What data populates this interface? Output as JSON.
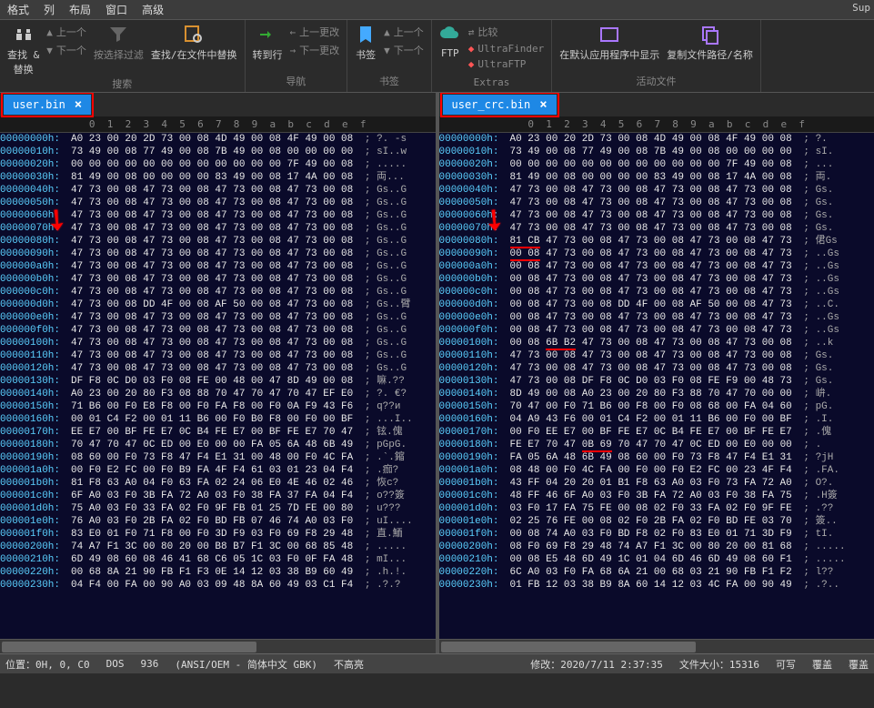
{
  "menu": {
    "items": [
      "格式",
      "列",
      "布局",
      "窗口",
      "高级"
    ]
  },
  "ribbon": {
    "find": {
      "label": "查找 &\n替换",
      "prev": "上一个",
      "next": "下一个"
    },
    "filter": "按选择过滤",
    "findInFiles": "查找/在文件中替换",
    "searchGroup": "搜索",
    "gotoLine": "转到行",
    "prevChange": "上一更改",
    "nextChange": "下一更改",
    "navGroup": "导航",
    "bookmark": {
      "label": "书签",
      "prev": "上一个",
      "next": "下一个"
    },
    "bmGroup": "书签",
    "ftp": "FTP",
    "compare": "比较",
    "ultrafinder": "UltraFinder",
    "ultraftp": "UltraFTP",
    "extrasGroup": "Extras",
    "openDefault": "在默认应用程序中显示",
    "copyPath": "复制文件路径/名称",
    "activeFileGroup": "活动文件",
    "superLabel": "Sup"
  },
  "ruler": "   0  1  2  3  4  5  6  7  8  9  a  b  c  d  e  f",
  "leftPane": {
    "tab": {
      "name": "user.bin"
    },
    "rows": [
      {
        "off": "00000000h:",
        "hex": "A0 23 00 20 2D 73 00 08 4D 49 00 08 4F 49 00 08",
        "asc": "; ?. -s"
      },
      {
        "off": "00000010h:",
        "hex": "73 49 00 08 77 49 00 08 7B 49 00 08 00 00 00 00",
        "asc": "; sI..w"
      },
      {
        "off": "00000020h:",
        "hex": "00 00 00 00 00 00 00 00 00 00 00 00 7F 49 00 08",
        "asc": "; ....."
      },
      {
        "off": "00000030h:",
        "hex": "81 49 00 08 00 00 00 00 83 49 00 08 17 4A 00 08",
        "asc": "; 両..."
      },
      {
        "off": "00000040h:",
        "hex": "47 73 00 08 47 73 00 08 47 73 00 08 47 73 00 08",
        "asc": "; Gs..G"
      },
      {
        "off": "00000050h:",
        "hex": "47 73 00 08 47 73 00 08 47 73 00 08 47 73 00 08",
        "asc": "; Gs..G"
      },
      {
        "off": "00000060h:",
        "hex": "47 73 00 08 47 73 00 08 47 73 00 08 47 73 00 08",
        "asc": "; Gs..G"
      },
      {
        "off": "00000070h:",
        "hex": "47 73 00 08 47 73 00 08 47 73 00 08 47 73 00 08",
        "asc": "; Gs..G"
      },
      {
        "off": "00000080h:",
        "hex": "47 73 00 08 47 73 00 08 47 73 00 08 47 73 00 08",
        "asc": "; Gs..G"
      },
      {
        "off": "00000090h:",
        "hex": "47 73 00 08 47 73 00 08 47 73 00 08 47 73 00 08",
        "asc": "; Gs..G"
      },
      {
        "off": "000000a0h:",
        "hex": "47 73 00 08 47 73 00 08 47 73 00 08 47 73 00 08",
        "asc": "; Gs..G"
      },
      {
        "off": "000000b0h:",
        "hex": "47 73 00 08 47 73 00 08 47 73 00 08 47 73 00 08",
        "asc": "; Gs..G"
      },
      {
        "off": "000000c0h:",
        "hex": "47 73 00 08 47 73 00 08 47 73 00 08 47 73 00 08",
        "asc": "; Gs..G"
      },
      {
        "off": "000000d0h:",
        "hex": "47 73 00 08 DD 4F 00 08 AF 50 00 08 47 73 00 08",
        "asc": "; Gs..臂"
      },
      {
        "off": "000000e0h:",
        "hex": "47 73 00 08 47 73 00 08 47 73 00 08 47 73 00 08",
        "asc": "; Gs..G"
      },
      {
        "off": "000000f0h:",
        "hex": "47 73 00 08 47 73 00 08 47 73 00 08 47 73 00 08",
        "asc": "; Gs..G"
      },
      {
        "off": "00000100h:",
        "hex": "47 73 00 08 47 73 00 08 47 73 00 08 47 73 00 08",
        "asc": "; Gs..G"
      },
      {
        "off": "00000110h:",
        "hex": "47 73 00 08 47 73 00 08 47 73 00 08 47 73 00 08",
        "asc": "; Gs..G"
      },
      {
        "off": "00000120h:",
        "hex": "47 73 00 08 47 73 00 08 47 73 00 08 47 73 00 08",
        "asc": "; Gs..G"
      },
      {
        "off": "00000130h:",
        "hex": "DF F8 0C D0 03 F0 08 FE 00 48 00 47 8D 49 00 08",
        "asc": "; 嘛.??"
      },
      {
        "off": "00000140h:",
        "hex": "A0 23 00 20 80 F3 08 88 70 47 70 47 70 47 EF E0",
        "asc": "; ?. €?"
      },
      {
        "off": "00000150h:",
        "hex": "71 B6 00 F0 E8 F8 00 F0 FA F8 00 F0 0A F9 43 F6",
        "asc": "; q??и"
      },
      {
        "off": "00000160h:",
        "hex": "00 01 C4 F2 00 01 11 B6 00 F0 B0 F8 00 F0 00 BF",
        "asc": "; ...I.."
      },
      {
        "off": "00000170h:",
        "hex": "EE E7 00 BF FE E7 0C B4 FE E7 00 BF FE E7 70 47",
        "asc": "; 铉.傀"
      },
      {
        "off": "00000180h:",
        "hex": "70 47 70 47 0C ED 00 E0 00 00 FA 05 6A 48 6B 49",
        "asc": "; pGpG."
      },
      {
        "off": "00000190h:",
        "hex": "08 60 00 F0 73 F8 47 F4 E1 31 00 48 00 F0 4C FA",
        "asc": "; .`.鏥"
      },
      {
        "off": "000001a0h:",
        "hex": "00 F0 E2 FC 00 F0 B9 FA 4F F4 61 03 01 23 04 F4",
        "asc": "; .痂?"
      },
      {
        "off": "000001b0h:",
        "hex": "81 F8 63 A0 04 F0 63 FA 02 24 06 E0 4E 46 02 46",
        "asc": "; 恢c?"
      },
      {
        "off": "000001c0h:",
        "hex": "6F A0 03 F0 3B FA 72 A0 03 F0 38 FA 37 FA 04 F4",
        "asc": "; o??簽"
      },
      {
        "off": "000001d0h:",
        "hex": "75 A0 03 F0 33 FA 02 F0 9F FB 01 25 7D FE 00 80",
        "asc": "; u???"
      },
      {
        "off": "000001e0h:",
        "hex": "76 A0 03 F0 2B FA 02 F0 BD FB 07 46 74 A0 03 F0",
        "asc": "; uI...."
      },
      {
        "off": "000001f0h:",
        "hex": "83 E0 01 F0 71 F8 00 F0 3D F9 03 F0 69 F8 29 48",
        "asc": "; 直.鮞"
      },
      {
        "off": "00000200h:",
        "hex": "74 A7 F1 3C 00 80 20 00 B8 B7 F1 3C 00 68 85 48",
        "asc": "; ....."
      },
      {
        "off": "00000210h:",
        "hex": "6D 49 08 60 08 46 41 68 C6 05 1C 03 F0 0F FA 48",
        "asc": "; mI..."
      },
      {
        "off": "00000220h:",
        "hex": "00 68 8A 21 90 FB F1 F3 0E 14 12 03 38 B9 60 49",
        "asc": "; .h.!."
      },
      {
        "off": "00000230h:",
        "hex": "04 F4 00 FA 00 90 A0 03 09 48 8A 60 49 03 C1 F4",
        "asc": "; .?.?"
      }
    ]
  },
  "rightPane": {
    "tab": {
      "name": "user_crc.bin"
    },
    "rows": [
      {
        "off": "00000000h:",
        "hex": "A0 23 00 20 2D 73 00 08 4D 49 00 08 4F 49 00 08",
        "asc": "; ?."
      },
      {
        "off": "00000010h:",
        "hex": "73 49 00 08 77 49 00 08 7B 49 00 08 00 00 00 00",
        "asc": "; sI."
      },
      {
        "off": "00000020h:",
        "hex": "00 00 00 00 00 00 00 00 00 00 00 00 7F 49 00 08",
        "asc": "; ..."
      },
      {
        "off": "00000030h:",
        "hex": "81 49 00 08 00 00 00 00 83 49 00 08 17 4A 00 08",
        "asc": "; 両."
      },
      {
        "off": "00000040h:",
        "hex": "47 73 00 08 47 73 00 08 47 73 00 08 47 73 00 08",
        "asc": "; Gs."
      },
      {
        "off": "00000050h:",
        "hex": "47 73 00 08 47 73 00 08 47 73 00 08 47 73 00 08",
        "asc": "; Gs."
      },
      {
        "off": "00000060h:",
        "hex": "47 73 00 08 47 73 00 08 47 73 00 08 47 73 00 08",
        "asc": "; Gs."
      },
      {
        "off": "00000070h:",
        "hex": "47 73 00 08 47 73 00 08 47 73 00 08 47 73 00 08",
        "asc": "; Gs."
      },
      {
        "off": "00000080h:",
        "hex": "81 CB 47 73 00 08 47 73 00 08 47 73 00 08 47 73",
        "asc": "; 侰Gs",
        "hl": [
          0,
          5
        ]
      },
      {
        "off": "00000090h:",
        "hex": "00 08 47 73 00 08 47 73 00 08 47 73 00 08 47 73",
        "asc": "; ..Gs",
        "hl": [
          0,
          5
        ]
      },
      {
        "off": "000000a0h:",
        "hex": "00 08 47 73 00 08 47 73 00 08 47 73 00 08 47 73",
        "asc": "; ..Gs"
      },
      {
        "off": "000000b0h:",
        "hex": "00 08 47 73 00 08 47 73 00 08 47 73 00 08 47 73",
        "asc": "; ..Gs"
      },
      {
        "off": "000000c0h:",
        "hex": "00 08 47 73 00 08 47 73 00 08 47 73 00 08 47 73",
        "asc": "; ..Gs"
      },
      {
        "off": "000000d0h:",
        "hex": "00 08 47 73 00 08 DD 4F 00 08 AF 50 00 08 47 73",
        "asc": "; ..C."
      },
      {
        "off": "000000e0h:",
        "hex": "00 08 47 73 00 08 47 73 00 08 47 73 00 08 47 73",
        "asc": "; ..Gs"
      },
      {
        "off": "000000f0h:",
        "hex": "00 08 47 73 00 08 47 73 00 08 47 73 00 08 47 73",
        "asc": "; ..Gs"
      },
      {
        "off": "00000100h:",
        "hex": "00 08 6B B2 47 73 00 08 47 73 00 08 47 73 00 08",
        "asc": "; ..k",
        "hl": [
          6,
          11
        ]
      },
      {
        "off": "00000110h:",
        "hex": "47 73 00 08 47 73 00 08 47 73 00 08 47 73 00 08",
        "asc": "; Gs."
      },
      {
        "off": "00000120h:",
        "hex": "47 73 00 08 47 73 00 08 47 73 00 08 47 73 00 08",
        "asc": "; Gs."
      },
      {
        "off": "00000130h:",
        "hex": "47 73 00 08 DF F8 0C D0 03 F0 08 FE F9 00 48 73",
        "asc": "; Gs."
      },
      {
        "off": "00000140h:",
        "hex": "8D 49 00 08 A0 23 00 20 80 F3 88 70 47 70 00 00",
        "asc": "; 峅."
      },
      {
        "off": "00000150h:",
        "hex": "70 47 00 F0 71 B6 00 F8 00 F0 08 68 00 FA 04 60",
        "asc": "; pG."
      },
      {
        "off": "00000160h:",
        "hex": "04 A9 43 F6 00 01 C4 F2 00 01 11 B6 00 F0 00 BF",
        "asc": "; .I."
      },
      {
        "off": "00000170h:",
        "hex": "00 F0 EE E7 00 BF FE E7 0C B4 FE E7 00 BF FE E7",
        "asc": "; .傀"
      },
      {
        "off": "00000180h:",
        "hex": "FE E7 70 47 0B 69 70 47 70 47 0C ED 00 E0 00 00",
        "asc": "; .",
        "hl": [
          12,
          17
        ]
      },
      {
        "off": "00000190h:",
        "hex": "FA 05 6A 48 6B 49 08 60 00 F0 73 F8 47 F4 E1 31",
        "asc": "; ?jH"
      },
      {
        "off": "000001a0h:",
        "hex": "08 48 00 F0 4C FA 00 F0 00 F0 E2 FC 00 23 4F F4",
        "asc": "; .FA."
      },
      {
        "off": "000001b0h:",
        "hex": "43 FF 04 20 20 01 B1 F8 63 A0 03 F0 73 FA 72 A0",
        "asc": "; O?."
      },
      {
        "off": "000001c0h:",
        "hex": "48 FF 46 6F A0 03 F0 3B FA 72 A0 03 F0 38 FA 75",
        "asc": "; .H簽"
      },
      {
        "off": "000001d0h:",
        "hex": "03 F0 17 FA 75 FE 00 08 02 F0 33 FA 02 F0 9F FE",
        "asc": "; .??"
      },
      {
        "off": "000001e0h:",
        "hex": "02 25 76 FE 00 08 02 F0 2B FA 02 F0 BD FE 03 70",
        "asc": "; 簽.."
      },
      {
        "off": "000001f0h:",
        "hex": "00 08 74 A0 03 F0 BD F8 02 F0 83 E0 01 71 3D F9",
        "asc": "; tI."
      },
      {
        "off": "00000200h:",
        "hex": "08 F0 69 F8 29 48 74 A7 F1 3C 00 80 20 00 81 68",
        "asc": "; ....."
      },
      {
        "off": "00000210h:",
        "hex": "00 08 E5 48 6D 49 1C 01 04 6D 46 6D 49 08 60 F1",
        "asc": "; ....."
      },
      {
        "off": "00000220h:",
        "hex": "6C A0 03 F0 FA 68 6A 21 00 68 03 21 90 FB F1 F2",
        "asc": "; l??"
      },
      {
        "off": "00000230h:",
        "hex": "01 FB 12 03 38 B9 8A 60 14 12 03 4C FA 00 90 49",
        "asc": "; .?.."
      }
    ]
  },
  "status": {
    "pos": "位置：0H, 0, C0",
    "dos": "DOS",
    "page": "936",
    "encoding": "(ANSI/OEM - 简体中文 GBK)",
    "highlight": "不高亮",
    "modified": "修改：2020/7/11 2:37:35",
    "size": "文件大小：15316",
    "writable": "可写",
    "ovr1": "覆盖",
    "ovr2": "覆盖"
  }
}
